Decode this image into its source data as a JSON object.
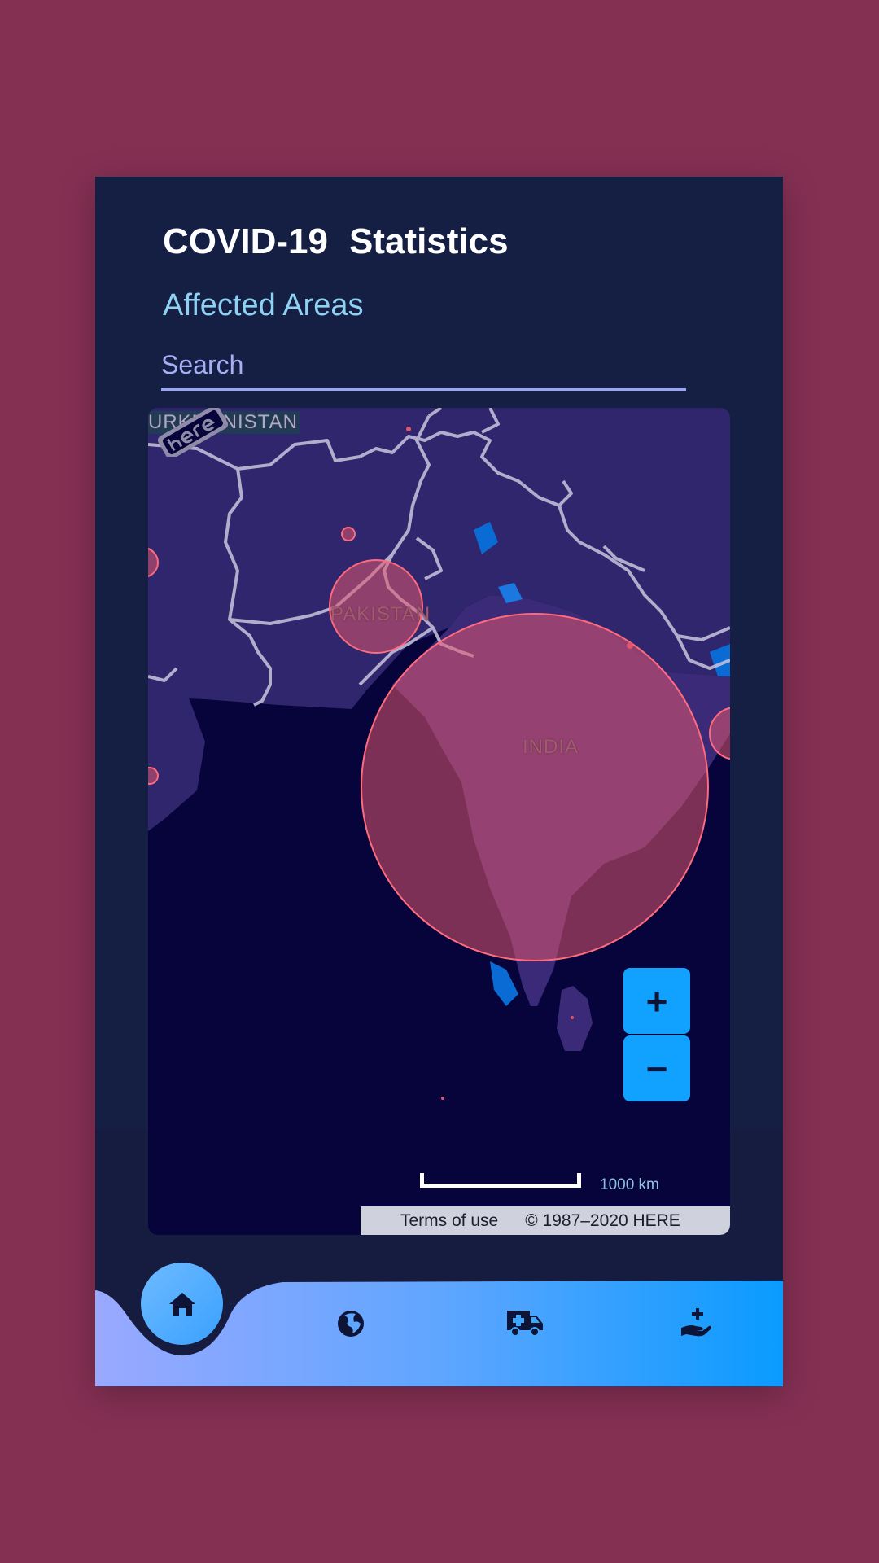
{
  "header": {
    "title_part1": "COVID-19",
    "title_part2": "Statistics",
    "subtitle": "Affected Areas"
  },
  "search": {
    "placeholder": "Search",
    "value": ""
  },
  "map": {
    "country_labels": [
      "URKMENISTAN",
      "PAKISTAN",
      "INDIA"
    ],
    "zoom_in_label": "+",
    "zoom_out_label": "−",
    "scale_label": "1000 km",
    "terms_label": "Terms of use",
    "copyright": "© 1987–2020 HERE",
    "provider_logo": "here-logo",
    "hotspot_color": "#e0566e"
  },
  "nav": {
    "items": [
      {
        "icon": "home-icon",
        "active": true
      },
      {
        "icon": "globe-icon",
        "active": false
      },
      {
        "icon": "ambulance-icon",
        "active": false
      },
      {
        "icon": "hand-medical-icon",
        "active": false
      }
    ]
  },
  "colors": {
    "background": "#843053",
    "card": "#141f43",
    "accent": "#11a2ff",
    "subtitle": "#8fd1f2"
  }
}
